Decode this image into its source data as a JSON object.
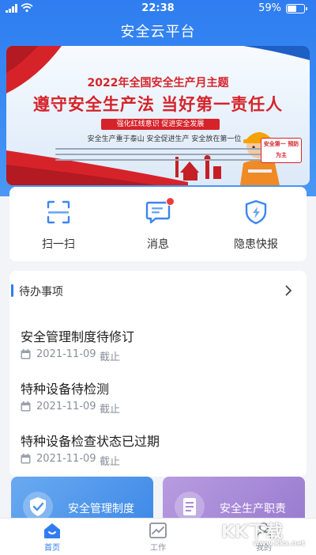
{
  "status_bar": {
    "time": "22:38",
    "battery": "59%"
  },
  "header": {
    "title": "安全云平台"
  },
  "banner": {
    "heading": "2022年全国安全生产月主题",
    "headline": "遵守安全生产法 当好第一责任人",
    "tag": "强化红线意识 促进安全发展",
    "slogan": "安全生产重于泰山 安全促进生产 安全放在第一位",
    "badge": "安全第一 预防为主"
  },
  "quick_actions": [
    {
      "label": "扫一扫",
      "icon": "scan-icon"
    },
    {
      "label": "消息",
      "icon": "message-icon"
    },
    {
      "label": "隐患快报",
      "icon": "hazard-shield-icon"
    }
  ],
  "todo": {
    "title": "待办事项",
    "items": [
      {
        "name": "安全管理制度待修订",
        "date": "2021-11-09",
        "due": "截止"
      },
      {
        "name": "特种设备待检测",
        "date": "2021-11-09",
        "due": "截止"
      },
      {
        "name": "特种设备检查状态已过期",
        "date": "2021-11-09",
        "due": "截止"
      }
    ]
  },
  "cards": [
    {
      "label": "安全管理制度",
      "color": "#5aa0ea",
      "icon": "shield-check-icon"
    },
    {
      "label": "安全生产职责",
      "color": "#a98ad6",
      "icon": "document-icon"
    }
  ],
  "tabs": [
    {
      "label": "首页",
      "icon": "home-icon",
      "active": true
    },
    {
      "label": "工作",
      "icon": "chart-icon",
      "active": false
    },
    {
      "label": "我的",
      "icon": "user-icon",
      "active": false
    }
  ],
  "watermark": {
    "text": "KK下载",
    "sub": "www.kkx.net"
  },
  "colors": {
    "primary": "#2f7df0",
    "danger": "#d6232a"
  }
}
